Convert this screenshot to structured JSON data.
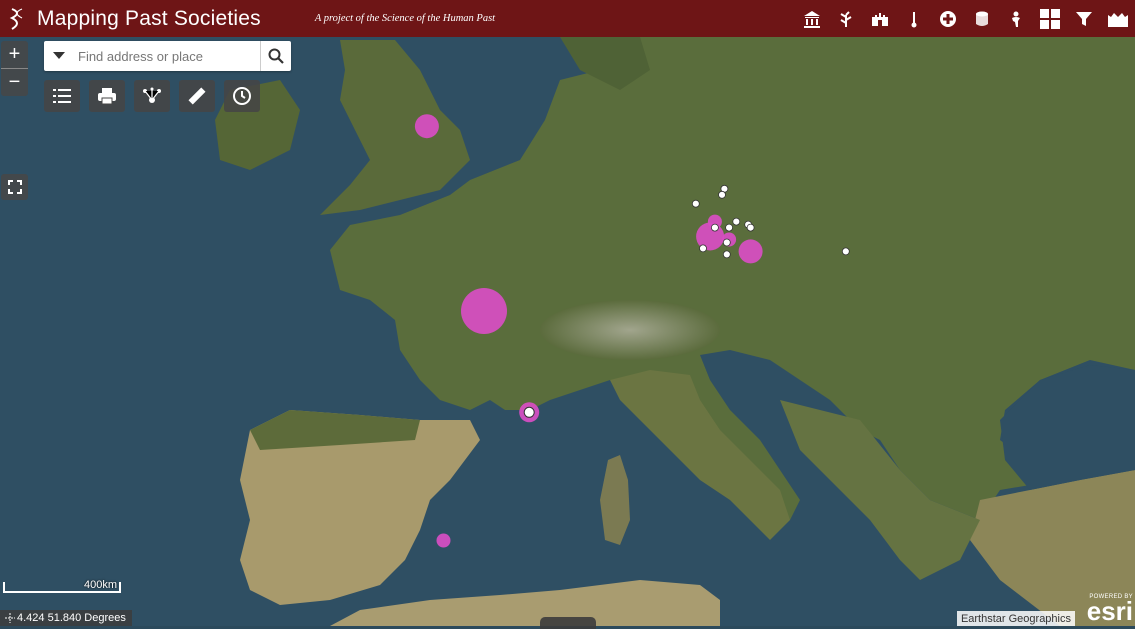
{
  "header": {
    "title": "Mapping Past Societies",
    "subtitle": "A project of the Science of the Human Past",
    "icons": [
      "museum-icon",
      "plant-icon",
      "fortress-icon",
      "thermometer-icon",
      "health-cross-icon",
      "database-icon",
      "figure-icon",
      "grid-icon",
      "filter-icon",
      "castle-icon"
    ]
  },
  "search": {
    "placeholder": "Find address or place"
  },
  "toolbar": {
    "tools": [
      "layer-list-icon",
      "print-icon",
      "analysis-icon",
      "measure-icon",
      "history-icon"
    ]
  },
  "zoom": {
    "in": "+",
    "out": "−"
  },
  "scale": {
    "label": "400km"
  },
  "coords": {
    "text": "4.424 51.840 Degrees"
  },
  "attribution": "Earthstar Geographics",
  "esri": {
    "powered": "POWERED BY",
    "name": "esri"
  },
  "colors": {
    "header": "#6e1516",
    "magenta": "#d94ec4",
    "white_dot": "#ffffff"
  },
  "map_points": {
    "large": [
      {
        "lon": -1.2,
        "lat": 53.1,
        "size": "medium"
      },
      {
        "lon": 1.2,
        "lat": 46.9,
        "size": "large"
      },
      {
        "lon": 3.1,
        "lat": 43.5,
        "size": "ringed"
      },
      {
        "lon": -0.5,
        "lat": 39.2,
        "size": "small"
      },
      {
        "lon": 10.9,
        "lat": 49.9,
        "size": "small"
      },
      {
        "lon": 10.7,
        "lat": 49.4,
        "size": "medium-large"
      },
      {
        "lon": 11.5,
        "lat": 49.3,
        "size": "small"
      },
      {
        "lon": 12.4,
        "lat": 48.9,
        "size": "medium"
      }
    ],
    "white": [
      {
        "lon": 11.3,
        "lat": 51.0
      },
      {
        "lon": 11.2,
        "lat": 50.8
      },
      {
        "lon": 10.1,
        "lat": 50.5
      },
      {
        "lon": 11.8,
        "lat": 49.9
      },
      {
        "lon": 12.3,
        "lat": 49.8
      },
      {
        "lon": 12.4,
        "lat": 49.7
      },
      {
        "lon": 10.9,
        "lat": 49.7
      },
      {
        "lon": 11.5,
        "lat": 49.7
      },
      {
        "lon": 11.4,
        "lat": 49.2
      },
      {
        "lon": 10.4,
        "lat": 49.0
      },
      {
        "lon": 11.4,
        "lat": 48.8
      },
      {
        "lon": 16.4,
        "lat": 48.9
      }
    ]
  }
}
